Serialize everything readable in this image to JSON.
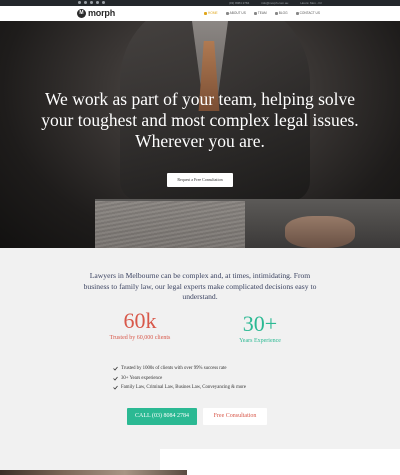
{
  "topbar": {
    "contacts": [
      "(03) 8084 2784",
      "info@morph.com.au",
      "Hours: Mon - Fri"
    ]
  },
  "brand": {
    "logo_glyph": "M",
    "name": "morph"
  },
  "nav": {
    "items": [
      {
        "label": "HOME",
        "active": true
      },
      {
        "label": "ABOUT US",
        "active": false
      },
      {
        "label": "TEAM",
        "active": false
      },
      {
        "label": "BLOG",
        "active": false
      },
      {
        "label": "CONTACT US",
        "active": false
      }
    ]
  },
  "hero": {
    "title": "We work as part of your team, helping solve your toughest and most complex legal issues. Wherever you are.",
    "cta_label": "Request a Free Consultation"
  },
  "intro": {
    "text": "Lawyers in Melbourne can be complex and, at times, intimidating. From business to family law, our legal experts make complicated decisions easy to understand."
  },
  "stats": [
    {
      "value": "60k",
      "label": "Trusted by 60,000 clients",
      "color": "#d8584a"
    },
    {
      "value": "30+",
      "label": "Years Experience",
      "color": "#2bb993"
    }
  ],
  "features": [
    "Trusted by 1000s of clients with over 99% success rate",
    "30+ Years experience",
    "Family Law, Criminal Law, Busines Law, Conveyancing & more"
  ],
  "buttons": {
    "call_label": "CALL (03) 8084 2784",
    "free_label": "Free Consultation"
  },
  "colors": {
    "accent_green": "#2bb993",
    "accent_red": "#d8584a",
    "nav_active": "#e0a61b",
    "intro_text": "#3a4260"
  }
}
